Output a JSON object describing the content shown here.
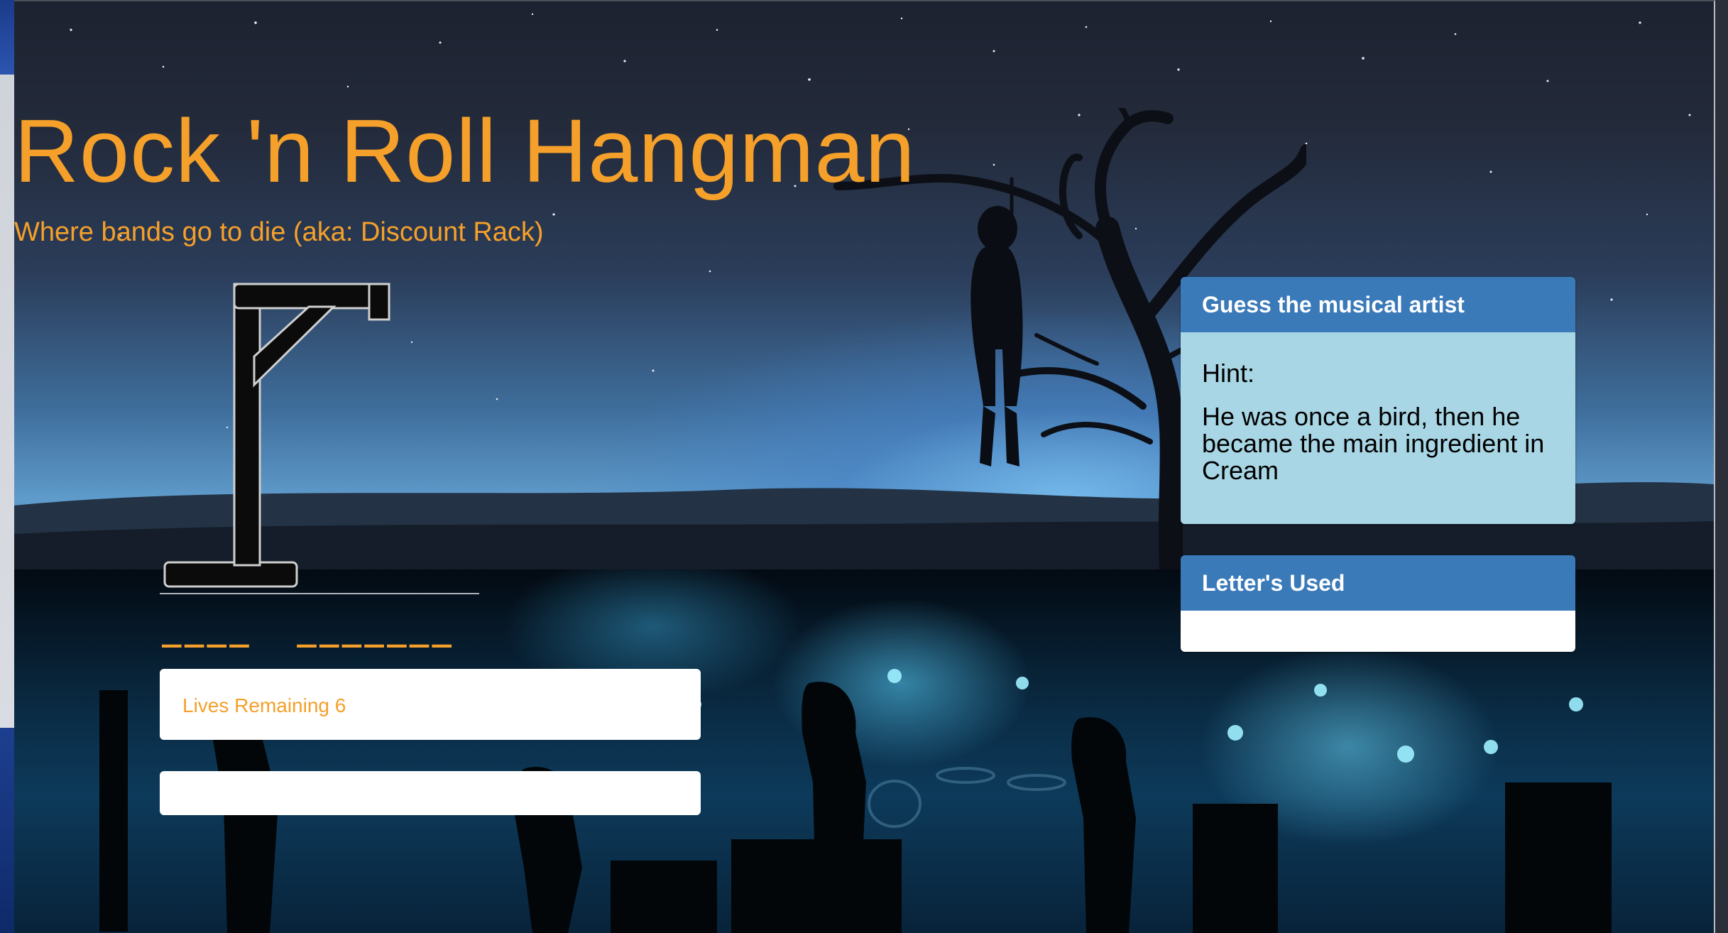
{
  "header": {
    "title": "Rock 'n Roll Hangman",
    "subtitle": "Where bands go to die (aka: Discount Rack)"
  },
  "game": {
    "word_blanks": "____  _______",
    "lives_label": "Lives Remaining 6"
  },
  "hint_panel": {
    "heading": "Guess the musical artist",
    "hint_label": "Hint:",
    "hint_text": "He was once a bird, then he became the main ingredient in Cream"
  },
  "letters_panel": {
    "heading": "Letter's Used",
    "letters": ""
  },
  "colors": {
    "accent": "#f5a02a",
    "panel_heading": "#3a7ab8",
    "hint_body": "#a9d6e5"
  }
}
